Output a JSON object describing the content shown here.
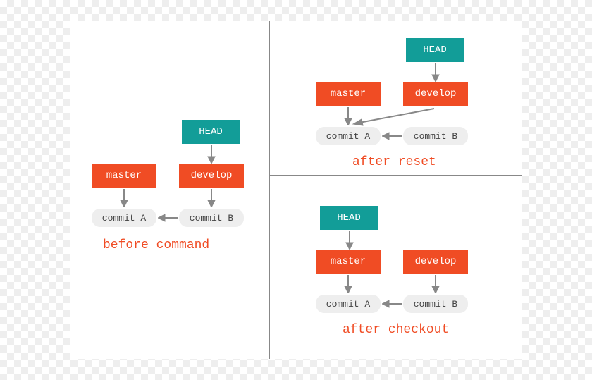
{
  "labels": {
    "head": "HEAD",
    "master": "master",
    "develop": "develop",
    "commitA": "commit A",
    "commitB": "commit B"
  },
  "captions": {
    "before": "before command",
    "reset": "after reset",
    "checkout": "after checkout"
  },
  "colors": {
    "head": "#129d98",
    "branch": "#f04c24",
    "commit": "#eeeeee",
    "caption": "#f04c24",
    "divider": "#888888"
  }
}
